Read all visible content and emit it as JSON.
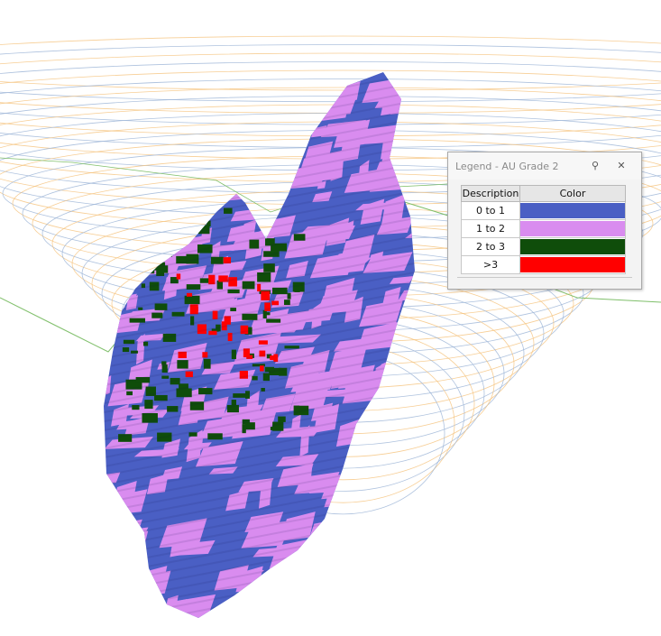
{
  "legend": {
    "title": "Legend - AU Grade 2",
    "pin_icon": "pin-icon",
    "close_icon": "close-icon",
    "columns": [
      "Description",
      "Color"
    ],
    "rows": [
      {
        "description": "0 to 1",
        "color": "#4a5fc4"
      },
      {
        "description": "1 to 2",
        "color": "#d98cef"
      },
      {
        "description": "2 to 3",
        "color": "#0f4d0a"
      },
      {
        "description": ">3",
        "color": "#ff0000"
      }
    ]
  },
  "scene": {
    "background": "#ffffff",
    "contour_colors": [
      "#f5c27a",
      "#9ab3d6",
      "#7fbf6a"
    ]
  }
}
